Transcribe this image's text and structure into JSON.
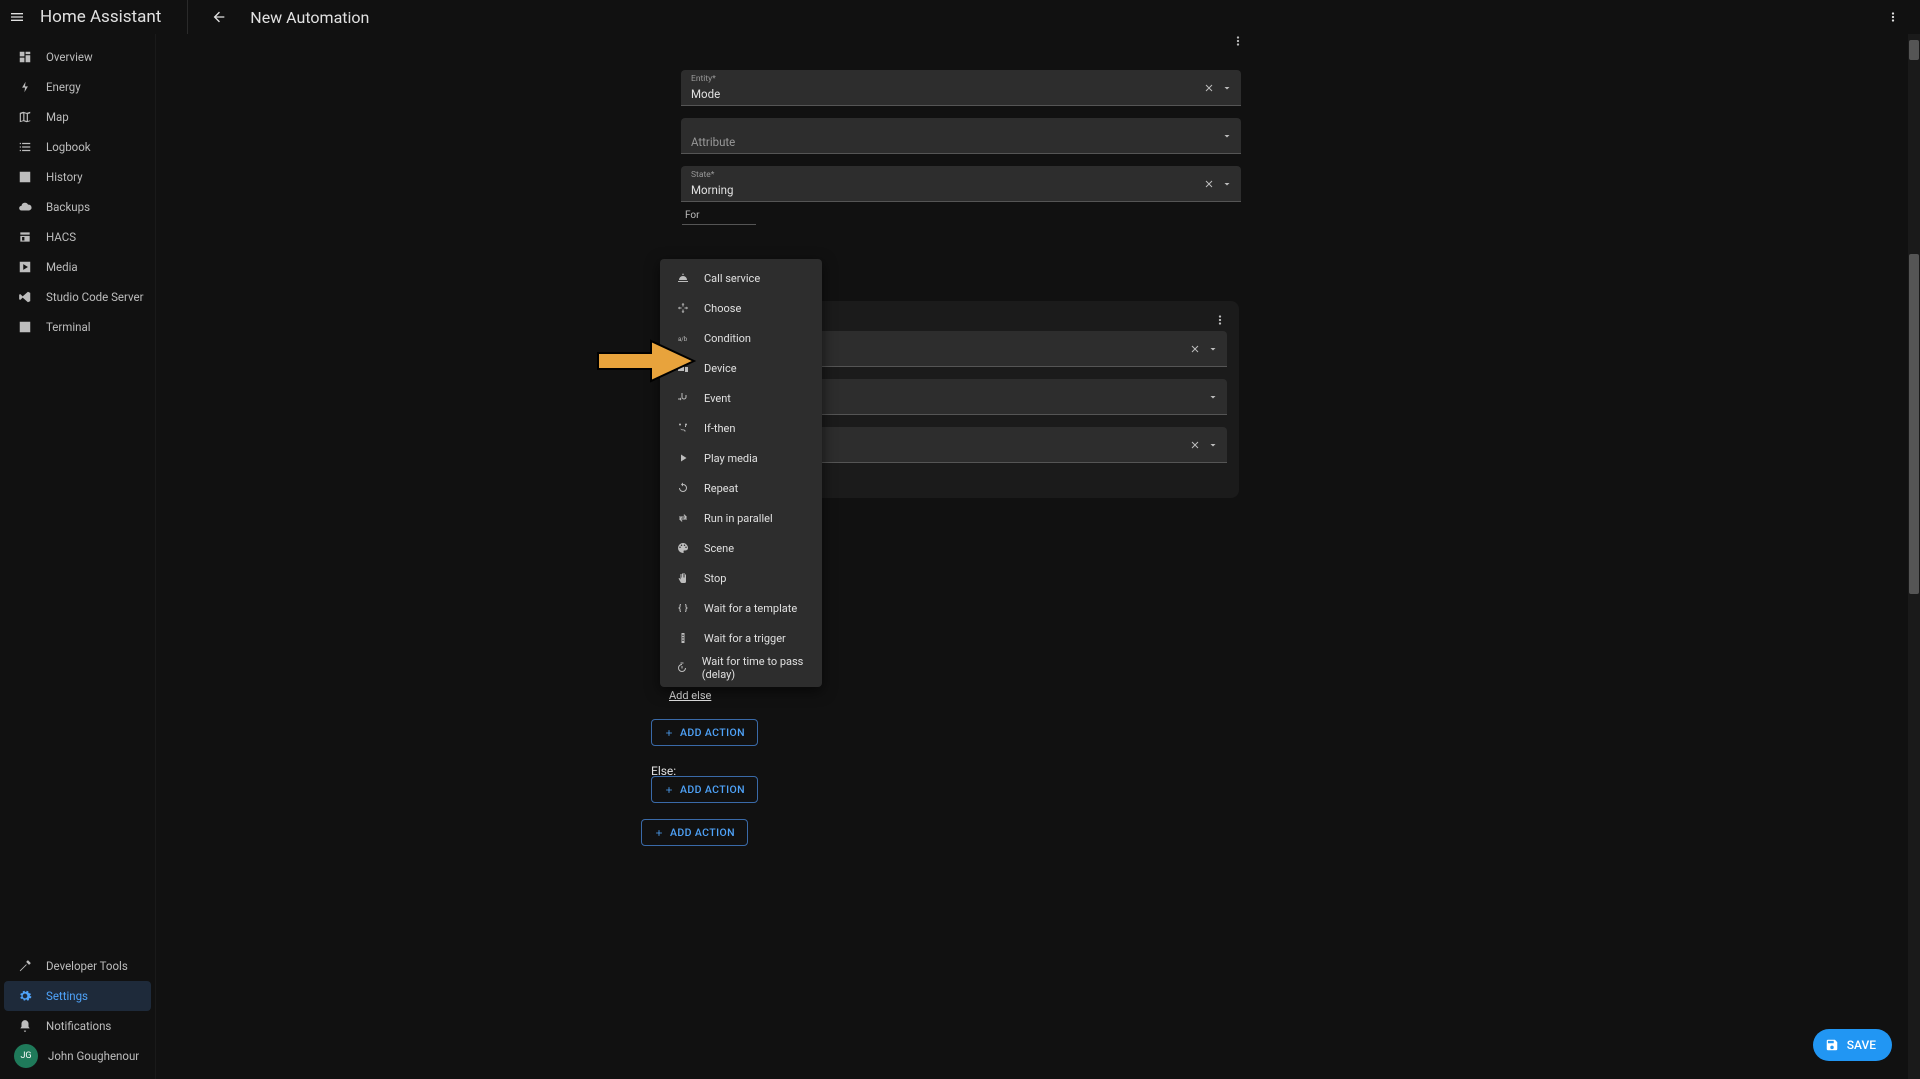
{
  "brand": "Home Assistant",
  "page_title": "New Automation",
  "sidebar": {
    "items": [
      {
        "label": "Overview"
      },
      {
        "label": "Energy"
      },
      {
        "label": "Map"
      },
      {
        "label": "Logbook"
      },
      {
        "label": "History"
      },
      {
        "label": "Backups"
      },
      {
        "label": "HACS"
      },
      {
        "label": "Media"
      },
      {
        "label": "Studio Code Server"
      },
      {
        "label": "Terminal"
      }
    ],
    "bottom": [
      {
        "label": "Developer Tools"
      },
      {
        "label": "Settings"
      },
      {
        "label": "Notifications"
      }
    ],
    "user_initials": "JG",
    "user_name": "John Goughenour"
  },
  "fields": {
    "entity_label": "Entity*",
    "entity_value": "Mode",
    "attribute_label": "Attribute",
    "state_label": "State*",
    "state_value": "Morning",
    "for_label": "For"
  },
  "dropdown": {
    "items": [
      "Call service",
      "Choose",
      "Condition",
      "Device",
      "Event",
      "If-then",
      "Play media",
      "Repeat",
      "Run in parallel",
      "Scene",
      "Stop",
      "Wait for a template",
      "Wait for a trigger",
      "Wait for time to pass (delay)"
    ]
  },
  "labels": {
    "add_else": "Add else",
    "else": "Else:",
    "add_action": "ADD ACTION",
    "save": "SAVE"
  },
  "colors": {
    "accent": "#2196f3",
    "arrow": "#e8a33c"
  }
}
